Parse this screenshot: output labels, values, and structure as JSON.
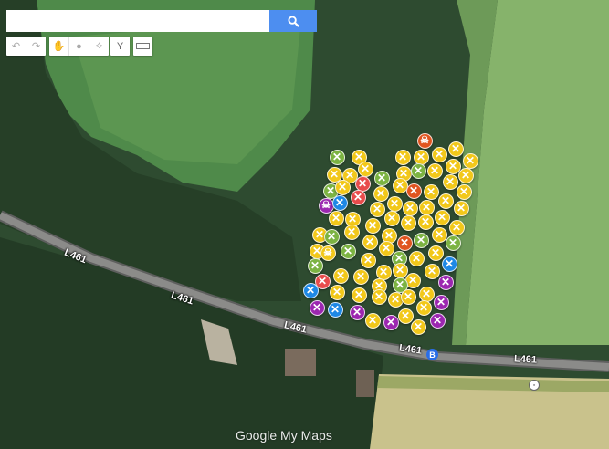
{
  "search": {
    "placeholder": "",
    "value": ""
  },
  "toolbar": {
    "undo": "undo-icon",
    "redo": "redo-icon",
    "pan": "hand-icon",
    "marker": "pin-icon",
    "line": "line-icon",
    "directions": "directions-icon",
    "measure": "ruler-icon"
  },
  "road_labels": [
    "L461",
    "L461",
    "L461",
    "L461",
    "L461"
  ],
  "bus_stop": "B",
  "logo": "Google My Maps",
  "colors": {
    "yellow": "#f2c81a",
    "green": "#7cb342",
    "red": "#e84c4c",
    "orange": "#e0541f",
    "purple": "#9c27b0",
    "blue": "#1e88e5",
    "accent": "#4d8ef0"
  },
  "markers": [
    {
      "color": "orange",
      "icon": "skull"
    },
    {
      "color": "green",
      "icon": "x"
    },
    {
      "color": "yellow",
      "icon": "x"
    },
    {
      "color": "yellow",
      "icon": "x"
    },
    {
      "color": "yellow",
      "icon": "x"
    },
    {
      "color": "yellow",
      "icon": "x"
    },
    {
      "color": "yellow",
      "icon": "x"
    },
    {
      "color": "yellow",
      "icon": "x"
    },
    {
      "color": "yellow",
      "icon": "x"
    },
    {
      "color": "yellow",
      "icon": "x"
    },
    {
      "color": "yellow",
      "icon": "x"
    },
    {
      "color": "red",
      "icon": "x"
    },
    {
      "color": "green",
      "icon": "x"
    },
    {
      "color": "yellow",
      "icon": "x"
    },
    {
      "color": "green",
      "icon": "x"
    },
    {
      "color": "yellow",
      "icon": "x"
    },
    {
      "color": "yellow",
      "icon": "x"
    },
    {
      "color": "yellow",
      "icon": "x"
    },
    {
      "color": "green",
      "icon": "x"
    },
    {
      "color": "yellow",
      "icon": "x"
    },
    {
      "color": "red",
      "icon": "x"
    },
    {
      "color": "yellow",
      "icon": "x"
    },
    {
      "color": "yellow",
      "icon": "x"
    },
    {
      "color": "orange",
      "icon": "x"
    },
    {
      "color": "yellow",
      "icon": "x"
    },
    {
      "color": "yellow",
      "icon": "x"
    },
    {
      "color": "yellow",
      "icon": "x"
    },
    {
      "color": "purple",
      "icon": "skull"
    },
    {
      "color": "blue",
      "icon": "x"
    },
    {
      "color": "yellow",
      "icon": "x"
    },
    {
      "color": "yellow",
      "icon": "x"
    },
    {
      "color": "yellow",
      "icon": "x"
    },
    {
      "color": "yellow",
      "icon": "x"
    },
    {
      "color": "yellow",
      "icon": "x"
    },
    {
      "color": "yellow",
      "icon": "x"
    },
    {
      "color": "yellow",
      "icon": "x"
    },
    {
      "color": "yellow",
      "icon": "x"
    },
    {
      "color": "yellow",
      "icon": "x"
    },
    {
      "color": "yellow",
      "icon": "x"
    },
    {
      "color": "yellow",
      "icon": "x"
    },
    {
      "color": "yellow",
      "icon": "x"
    },
    {
      "color": "yellow",
      "icon": "x"
    },
    {
      "color": "yellow",
      "icon": "x"
    },
    {
      "color": "yellow",
      "icon": "x"
    },
    {
      "color": "green",
      "icon": "x"
    },
    {
      "color": "yellow",
      "icon": "x"
    },
    {
      "color": "yellow",
      "icon": "x"
    },
    {
      "color": "yellow",
      "icon": "x"
    },
    {
      "color": "orange",
      "icon": "x"
    },
    {
      "color": "green",
      "icon": "x"
    },
    {
      "color": "yellow",
      "icon": "x"
    },
    {
      "color": "green",
      "icon": "x"
    },
    {
      "color": "yellow",
      "icon": "x"
    },
    {
      "color": "yellow",
      "icon": "skull"
    },
    {
      "color": "green",
      "icon": "x"
    },
    {
      "color": "yellow",
      "icon": "x"
    },
    {
      "color": "yellow",
      "icon": "x"
    },
    {
      "color": "green",
      "icon": "x"
    },
    {
      "color": "yellow",
      "icon": "x"
    },
    {
      "color": "yellow",
      "icon": "x"
    },
    {
      "color": "blue",
      "icon": "x"
    },
    {
      "color": "green",
      "icon": "x"
    },
    {
      "color": "yellow",
      "icon": "x"
    },
    {
      "color": "yellow",
      "icon": "x"
    },
    {
      "color": "yellow",
      "icon": "x"
    },
    {
      "color": "yellow",
      "icon": "x"
    },
    {
      "color": "yellow",
      "icon": "x"
    },
    {
      "color": "yellow",
      "icon": "x"
    },
    {
      "color": "purple",
      "icon": "x"
    },
    {
      "color": "red",
      "icon": "x"
    },
    {
      "color": "blue",
      "icon": "x"
    },
    {
      "color": "yellow",
      "icon": "x"
    },
    {
      "color": "yellow",
      "icon": "x"
    },
    {
      "color": "yellow",
      "icon": "x"
    },
    {
      "color": "green",
      "icon": "x"
    },
    {
      "color": "yellow",
      "icon": "x"
    },
    {
      "color": "yellow",
      "icon": "x"
    },
    {
      "color": "yellow",
      "icon": "x"
    },
    {
      "color": "yellow",
      "icon": "x"
    },
    {
      "color": "purple",
      "icon": "x"
    },
    {
      "color": "purple",
      "icon": "x"
    },
    {
      "color": "blue",
      "icon": "x"
    },
    {
      "color": "purple",
      "icon": "x"
    },
    {
      "color": "yellow",
      "icon": "x"
    },
    {
      "color": "purple",
      "icon": "x"
    },
    {
      "color": "yellow",
      "icon": "x"
    },
    {
      "color": "yellow",
      "icon": "x"
    },
    {
      "color": "yellow",
      "icon": "x"
    },
    {
      "color": "purple",
      "icon": "x"
    }
  ]
}
